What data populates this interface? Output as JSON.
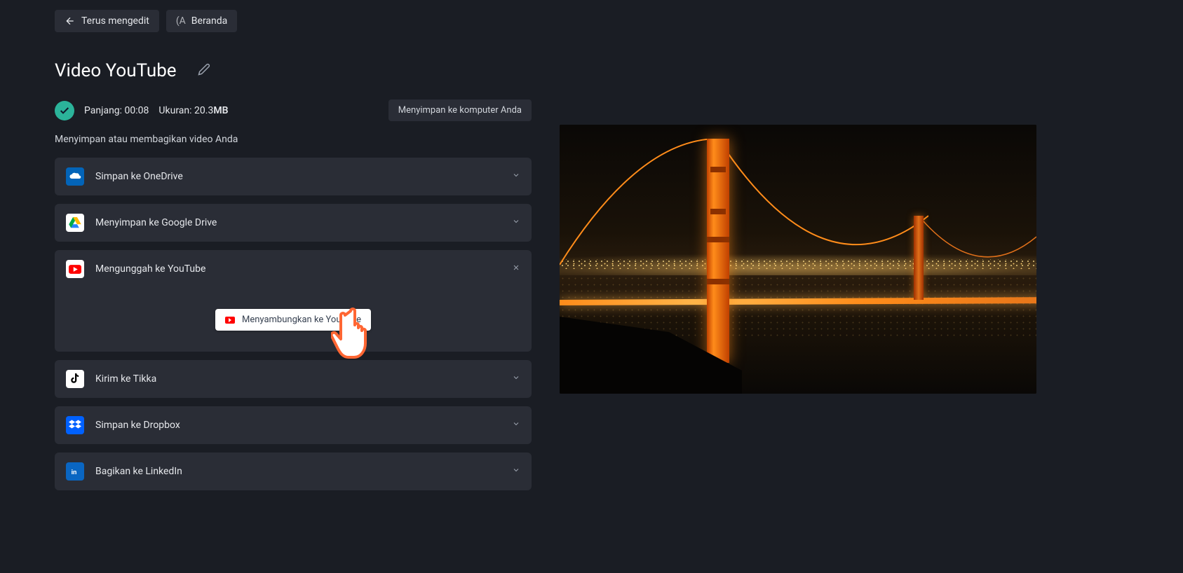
{
  "topbar": {
    "continue_edit": "Terus mengedit",
    "home": "Beranda",
    "home_prefix": "(A"
  },
  "title": "Video YouTube",
  "meta": {
    "length_label": "Panjang:",
    "length_value": "00:08",
    "size_label": "Ukuran:",
    "size_value": "20.3",
    "size_unit": "MB"
  },
  "save_computer": "Menyimpan ke komputer Anda",
  "subtitle": "Menyimpan atau membagikan video Anda",
  "options": {
    "onedrive": "Simpan ke OneDrive",
    "gdrive": "Menyimpan ke Google Drive",
    "youtube": "Mengunggah ke YouTube",
    "tiktok": "Kirim ke Tikka",
    "dropbox": "Simpan ke Dropbox",
    "linkedin": "Bagikan ke LinkedIn"
  },
  "connect_youtube": "Menyambungkan ke YouTube"
}
